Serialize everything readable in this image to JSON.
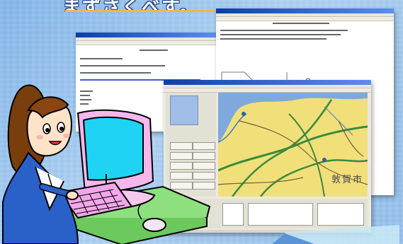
{
  "banner": {
    "text": "まずさくべす。"
  },
  "map_window": {
    "place_name": "敦賀市"
  }
}
